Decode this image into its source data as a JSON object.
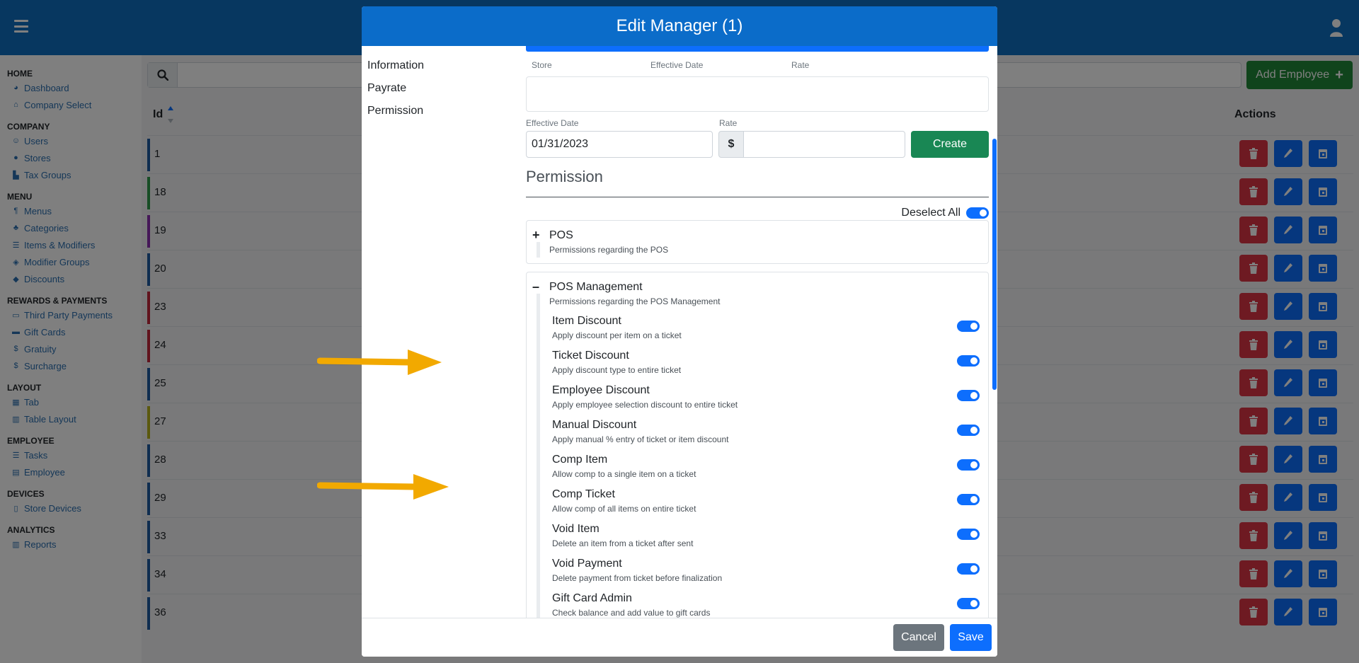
{
  "colors": {
    "topbar": "#0e6fc1",
    "modal_header": "#0b6cc9",
    "primary": "#0d6efd",
    "success": "#198754",
    "danger": "#dc3545",
    "secondary": "#6c757d",
    "arrow": "#f2a900"
  },
  "topbar": {
    "menu_icon": "hamburger-icon",
    "user_icon": "user-icon"
  },
  "sidebar": {
    "sections": [
      {
        "title": "HOME",
        "items": [
          {
            "label": "Dashboard",
            "icon": "palette-icon"
          },
          {
            "label": "Company Select",
            "icon": "home-icon"
          }
        ]
      },
      {
        "title": "COMPANY",
        "items": [
          {
            "label": "Users",
            "icon": "users-icon"
          },
          {
            "label": "Stores",
            "icon": "map-pin-icon"
          },
          {
            "label": "Tax Groups",
            "icon": "sitemap-icon"
          }
        ]
      },
      {
        "title": "MENU",
        "items": [
          {
            "label": "Menus",
            "icon": "utensils-icon"
          },
          {
            "label": "Categories",
            "icon": "shapes-icon"
          },
          {
            "label": "Items & Modifiers",
            "icon": "list-icon"
          },
          {
            "label": "Modifier Groups",
            "icon": "layer-group-icon"
          },
          {
            "label": "Discounts",
            "icon": "tags-icon"
          }
        ]
      },
      {
        "title": "REWARDS & PAYMENTS",
        "items": [
          {
            "label": "Third Party Payments",
            "icon": "money-icon"
          },
          {
            "label": "Gift Cards",
            "icon": "credit-card-icon"
          },
          {
            "label": "Gratuity",
            "icon": "dollar-icon"
          },
          {
            "label": "Surcharge",
            "icon": "dollar-icon"
          }
        ]
      },
      {
        "title": "LAYOUT",
        "items": [
          {
            "label": "Tab",
            "icon": "table-icon"
          },
          {
            "label": "Table Layout",
            "icon": "map-icon"
          }
        ]
      },
      {
        "title": "EMPLOYEE",
        "items": [
          {
            "label": "Tasks",
            "icon": "list-icon"
          },
          {
            "label": "Employee",
            "icon": "id-card-icon"
          }
        ]
      },
      {
        "title": "DEVICES",
        "items": [
          {
            "label": "Store Devices",
            "icon": "tablet-icon"
          }
        ]
      },
      {
        "title": "ANALYTICS",
        "items": [
          {
            "label": "Reports",
            "icon": "chart-icon"
          }
        ]
      }
    ]
  },
  "content": {
    "add_employee_label": "Add Employee",
    "id_header": "Id",
    "actions_header": "Actions",
    "rows": [
      {
        "id": "1",
        "color": "#1e5aa0"
      },
      {
        "id": "18",
        "color": "#2e9a4a"
      },
      {
        "id": "19",
        "color": "#8a2fb0"
      },
      {
        "id": "20",
        "color": "#1e5aa0"
      },
      {
        "id": "23",
        "color": "#c2263b"
      },
      {
        "id": "24",
        "color": "#c2263b"
      },
      {
        "id": "25",
        "color": "#1e5aa0"
      },
      {
        "id": "27",
        "color": "#b7b21c"
      },
      {
        "id": "28",
        "color": "#1e5aa0"
      },
      {
        "id": "29",
        "color": "#1e5aa0"
      },
      {
        "id": "33",
        "color": "#1e5aa0"
      },
      {
        "id": "34",
        "color": "#1e5aa0"
      },
      {
        "id": "36",
        "color": "#1e5aa0"
      }
    ]
  },
  "modal": {
    "title": "Edit Manager (1)",
    "nav": [
      "Information",
      "Payrate",
      "Permission"
    ],
    "payrate": {
      "col_store": "Store",
      "col_effective_date": "Effective Date",
      "col_rate": "Rate",
      "effective_date_label": "Effective Date",
      "effective_date_value": "01/31/2023",
      "rate_label": "Rate",
      "rate_prefix": "$",
      "rate_value": "",
      "create_label": "Create"
    },
    "permission": {
      "heading": "Permission",
      "deselect_all_label": "Deselect All",
      "deselect_all_on": true,
      "groups": [
        {
          "title": "POS",
          "description": "Permissions regarding the POS",
          "expanded": false
        },
        {
          "title": "POS Management",
          "description": "Permissions regarding the POS Management",
          "expanded": true,
          "items": [
            {
              "title": "Item Discount",
              "description": "Apply discount per item on a ticket",
              "enabled": true
            },
            {
              "title": "Ticket Discount",
              "description": "Apply discount type to entire ticket",
              "enabled": true
            },
            {
              "title": "Employee Discount",
              "description": "Apply employee selection discount to entire ticket",
              "enabled": true
            },
            {
              "title": "Manual Discount",
              "description": "Apply manual % entry of ticket or item discount",
              "enabled": true
            },
            {
              "title": "Comp Item",
              "description": "Allow comp to a single item on a ticket",
              "enabled": true
            },
            {
              "title": "Comp Ticket",
              "description": "Allow comp of all items on entire ticket",
              "enabled": true
            },
            {
              "title": "Void Item",
              "description": "Delete an item from a ticket after sent",
              "enabled": true
            },
            {
              "title": "Void Payment",
              "description": "Delete payment from ticket before finalization",
              "enabled": true
            },
            {
              "title": "Gift Card Admin",
              "description": "Check balance and add value to gift cards",
              "enabled": true
            }
          ]
        }
      ]
    },
    "footer": {
      "cancel_label": "Cancel",
      "save_label": "Save"
    }
  }
}
